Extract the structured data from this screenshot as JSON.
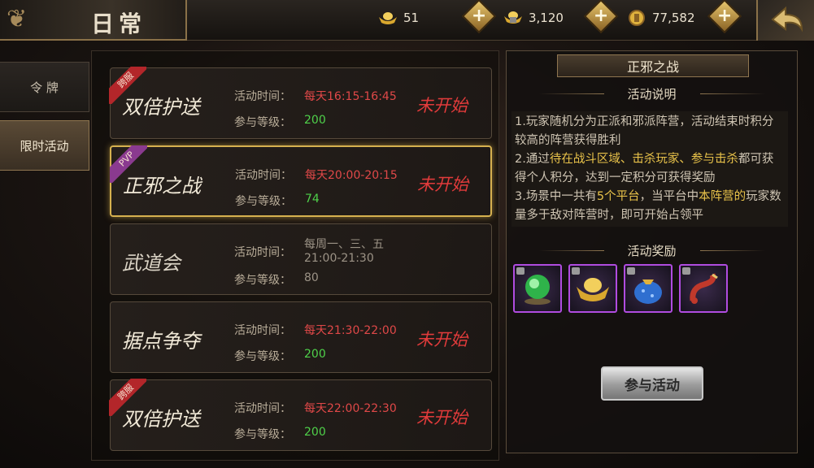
{
  "header": {
    "title": "日常",
    "resources": [
      {
        "icon": "gold-ingot-icon",
        "value": "51"
      },
      {
        "icon": "locked-ingot-icon",
        "value": "3,120"
      },
      {
        "icon": "coin-icon",
        "value": "77,582"
      }
    ]
  },
  "tabs": [
    {
      "label": "令 牌",
      "active": false
    },
    {
      "label": "限时活动",
      "active": true
    }
  ],
  "labels": {
    "time": "活动时间：",
    "level": "参与等级："
  },
  "activities": [
    {
      "name": "双倍护送",
      "badge": "跨服",
      "time": "每天16:15-16:45",
      "level": "200",
      "status": "未开始"
    },
    {
      "name": "正邪之战",
      "badge": "PVP",
      "time": "每天20:00-20:15",
      "level": "74",
      "status": "未开始"
    },
    {
      "name": "武道会",
      "badge": "",
      "time_line1": "每周一、三、五",
      "time_line2": "21:00-21:30",
      "level": "80",
      "status": ""
    },
    {
      "name": "据点争夺",
      "badge": "",
      "time": "每天21:30-22:00",
      "level": "200",
      "status": "未开始"
    },
    {
      "name": "双倍护送",
      "badge": "跨服",
      "time": "每天22:00-22:30",
      "level": "200",
      "status": "未开始"
    }
  ],
  "detail": {
    "title": "正邪之战",
    "description_title": "活动说明",
    "description": {
      "p1": "1.玩家随机分为正派和邪派阵营，活动结束时积分较高的阵营获得胜利",
      "p2_a": "2.通过",
      "p2_hl": "待在战斗区域、击杀玩家、参与击杀",
      "p2_b": "都可获得个人积分，达到一定积分可获得奖励",
      "p3_a": "3.场景中一共有",
      "p3_hl1": "5个平台",
      "p3_b": "，当平台中",
      "p3_hl2": "本阵营的",
      "p3_c": "玩家数量多于敌对阵营时，即可开始占领平"
    },
    "rewards_title": "活动奖励",
    "rewards": [
      {
        "icon": "jade-orb-icon"
      },
      {
        "icon": "gold-ingot-icon"
      },
      {
        "icon": "treasure-bag-icon"
      },
      {
        "icon": "scorpion-pet-icon"
      }
    ],
    "join_button": "参与活动"
  },
  "colors": {
    "accent_gold": "#d6b14f",
    "time_red": "#e04848",
    "level_green": "#4fd14a",
    "status_red": "#e23b3b",
    "reward_border": "#b04ce0"
  }
}
